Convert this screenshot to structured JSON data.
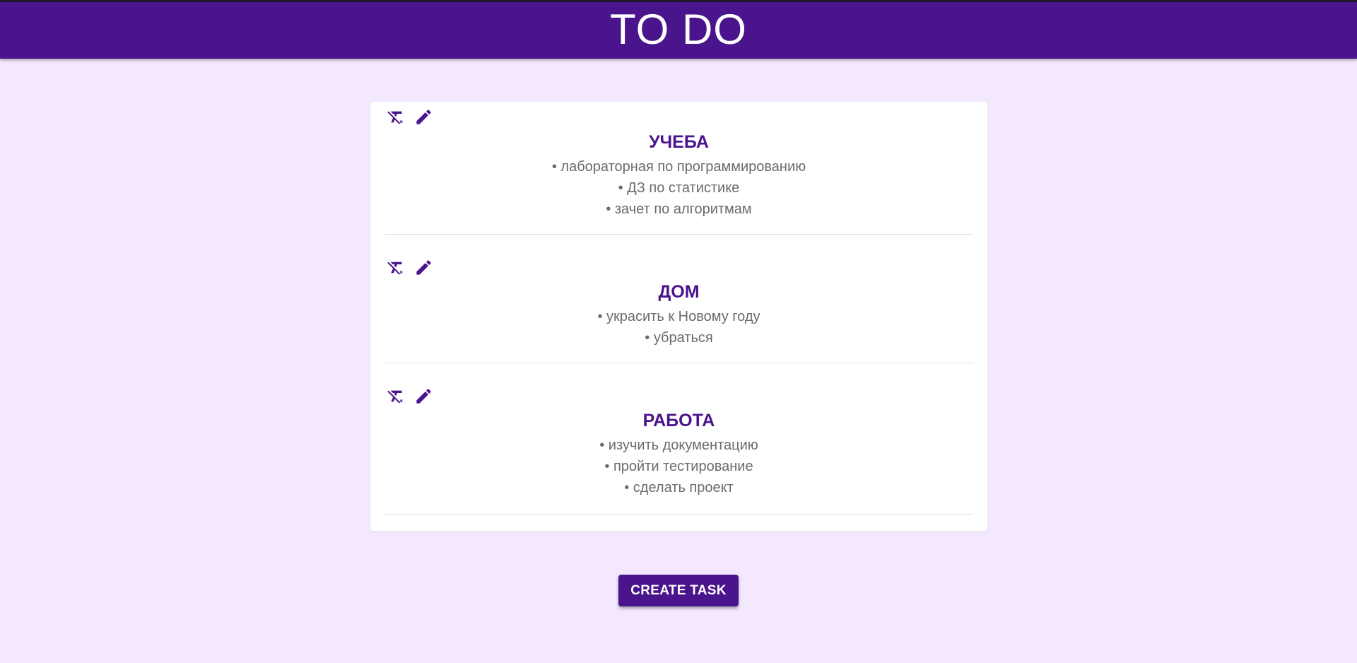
{
  "app": {
    "title": "TO DO"
  },
  "tasks": [
    {
      "title": "УЧЕБА",
      "items": [
        "лабораторная по программированию",
        "ДЗ по статистике",
        "зачет по алгоритмам"
      ]
    },
    {
      "title": "ДОМ",
      "items": [
        "украсить к Новому году",
        "убраться"
      ]
    },
    {
      "title": "РАБОТА",
      "items": [
        "изучить документацию",
        "пройти тестирование",
        "сделать проект"
      ]
    }
  ],
  "icons": {
    "delete": "format-clear-icon",
    "edit": "pencil-icon"
  },
  "actions": {
    "create_label": "CREATE TASK"
  },
  "colors": {
    "primary": "#4a148c",
    "background": "#f3e8fd",
    "card": "#ffffff",
    "item_text": "#6b6b6b"
  }
}
